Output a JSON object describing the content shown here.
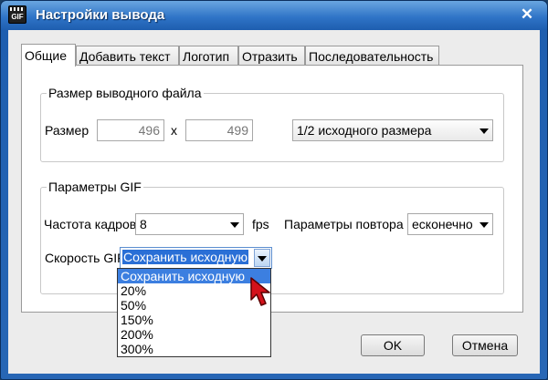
{
  "window": {
    "title": "Настройки вывода",
    "close_glyph": "✕",
    "app_icon_label": "GIF"
  },
  "tabs": [
    {
      "label": "Общие",
      "active": true
    },
    {
      "label": "Добавить текст",
      "active": false
    },
    {
      "label": "Логотип",
      "active": false
    },
    {
      "label": "Отразить",
      "active": false
    },
    {
      "label": "Последовательность",
      "active": false
    }
  ],
  "output_size": {
    "group_title": "Размер выводного файла",
    "size_label": "Размер",
    "width_value": "496",
    "separator": "x",
    "height_value": "499",
    "preset_value": "1/2 исходного размера"
  },
  "gif_params": {
    "group_title": "Параметры GIF",
    "frame_rate_label": "Частота кадров",
    "frame_rate_value": "8",
    "fps_unit": "fps",
    "repeat_label": "Параметры повтора",
    "repeat_value": "есконечно",
    "speed_label": "Скорость GIF",
    "speed_value": "Сохранить исходную",
    "speed_options": [
      "Сохранить исходную",
      "20%",
      "50%",
      "150%",
      "200%",
      "300%"
    ],
    "speed_selected_index": 0
  },
  "buttons": {
    "ok_label": "OK",
    "cancel_label": "Отмена"
  },
  "colors": {
    "titlebar": "#2f74c7",
    "selection": "#3c7fe0",
    "cursor": "#d4121b"
  },
  "icons": {
    "app": "gif-clapperboard-icon",
    "close": "close-icon",
    "dropdown": "chevron-down-icon",
    "pointer": "mouse-pointer-icon"
  }
}
